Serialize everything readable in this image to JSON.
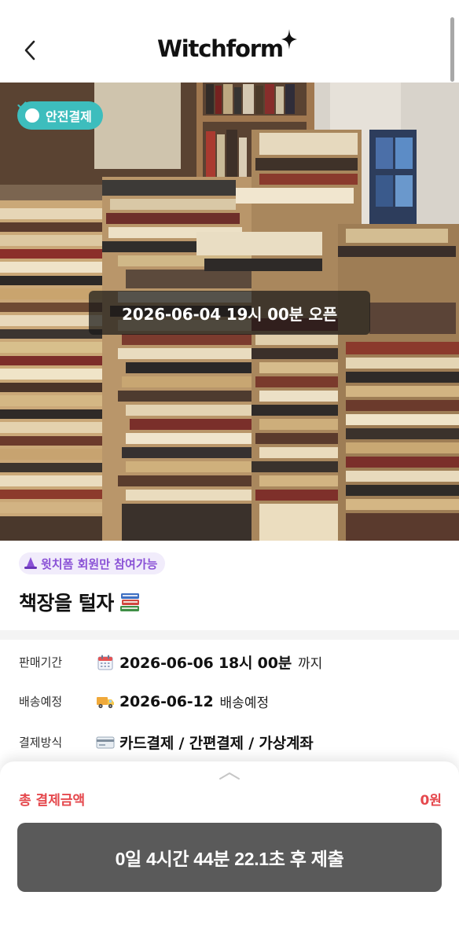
{
  "header": {
    "logo_text": "Witchform",
    "back_icon": "chevron-left-icon"
  },
  "hero": {
    "image_subject": "stacks-of-books-photo",
    "safe_payment_badge": "안전결제",
    "open_banner": "2026-06-04 19시 00분 오픈"
  },
  "product": {
    "member_chip": "윗치폼 회원만 참여가능",
    "title": "책장을 털자",
    "title_emoji": "📚"
  },
  "info": [
    {
      "label": "판매기간",
      "icon": "calendar-icon",
      "value": "2026-06-06 18시 00분",
      "suffix": "까지"
    },
    {
      "label": "배송예정",
      "icon": "truck-icon",
      "value": "2026-06-12",
      "suffix": "배송예정"
    },
    {
      "label": "결제방식",
      "icon": "card-icon",
      "value": "카드결제 / 간편결제 / 가상계좌",
      "suffix": ""
    }
  ],
  "sheet": {
    "total_label": "총 결제금액",
    "total_value": "0원",
    "submit_label": "0일 4시간 44분 22.1초 후 제출"
  },
  "colors": {
    "accent_red": "#e5484d",
    "badge_teal": "#3dbdbd",
    "chip_purple": "#8a52d6",
    "button_gray": "#5a5a5a"
  }
}
